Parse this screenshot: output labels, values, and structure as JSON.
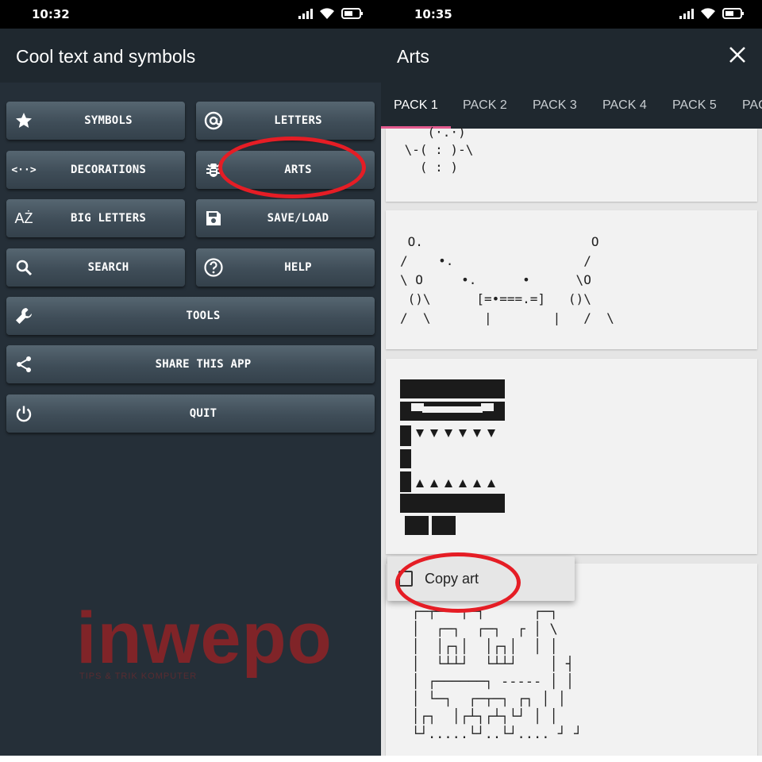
{
  "left": {
    "status_time": "10:32",
    "app_title": "Cool text and symbols",
    "buttons": {
      "symbols": "SYMBOLS",
      "letters": "LETTERS",
      "decorations": "DECORATIONS",
      "arts": "ARTS",
      "big_letters": "BIG LETTERS",
      "save_load": "SAVE/LOAD",
      "search": "SEARCH",
      "help": "HELP",
      "tools": "TOOLS",
      "share": "SHARE THIS APP",
      "quit": "QUIT"
    },
    "icons": {
      "decorations": "<··>",
      "big_letters": "AŻ"
    },
    "watermark": "inwepo",
    "watermark_sub": "TIPS & TRIK KOMPUTER"
  },
  "right": {
    "status_time": "10:35",
    "title": "Arts",
    "close_icon": "×",
    "tabs": [
      "PACK 1",
      "PACK 2",
      "PACK 3",
      "PACK 4",
      "PACK 5",
      "PAC"
    ],
    "arts": {
      "art1": "    (·.·)\n \\-( : )-\\\n   ( : )",
      "art2": " O.                      O\n/    •.                 /\n\\ O     •.      •      \\O\n ()\\      [=•===.=]   ()\\\n/  \\       |        |   /  \\",
      "art4": "  ┌─┬───┬─┐      ┌─┐\n  │  ┌─┐  ┌─┐  ┌ │ \\\n  │  │┌┐│  │┌┐│  │ │\n  │  └┴┴┘  └┴┴┘    │ ┤\n  │ ┌──────┐ ----- │ │\n  │ └─┐  ┌─┬─┐ ┌┐ │ │\n  │┌┐  │┌┴┐┌┴┐└┘ │ │\n  └┘.....└┘..└┘.... ┘ ┘"
    },
    "popup_label": "Copy art"
  },
  "colors": {
    "left_bg": "#252f38",
    "appbar": "#1f282f",
    "button": "#46545f",
    "tab_indicator": "#e45b8f",
    "highlight": "#e51d25",
    "watermark": "#8a2327"
  }
}
